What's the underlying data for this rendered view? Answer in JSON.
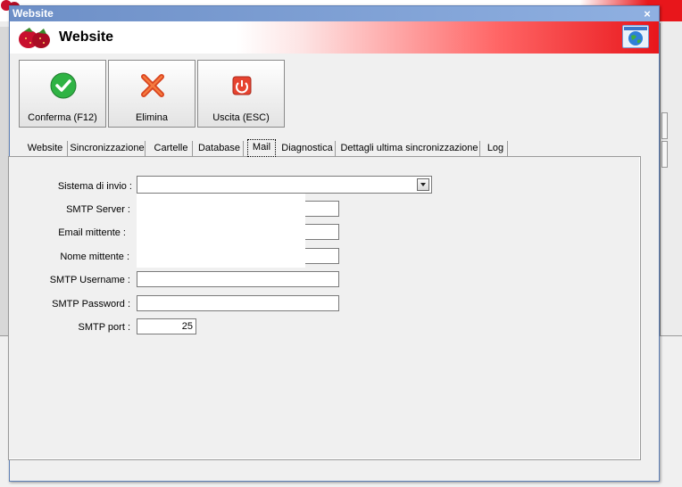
{
  "window": {
    "title": "Website",
    "close_glyph": "×"
  },
  "header": {
    "title": "Website",
    "logo_icon": "strawberry-icon",
    "globe_icon": "globe-icon"
  },
  "toolbar": {
    "buttons": [
      {
        "label": "Conferma (F12)",
        "icon": "check-icon"
      },
      {
        "label": "Elimina",
        "icon": "delete-x-icon"
      },
      {
        "label": "Uscita (ESC)",
        "icon": "power-icon"
      }
    ]
  },
  "tabs": [
    {
      "label": "Website",
      "active": false
    },
    {
      "label": "Sincronizzazione",
      "active": false
    },
    {
      "label": "Cartelle",
      "active": false
    },
    {
      "label": "Database",
      "active": false
    },
    {
      "label": "Mail",
      "active": true
    },
    {
      "label": "Diagnostica",
      "active": false
    },
    {
      "label": "Dettagli ultima sincronizzazione",
      "active": false
    },
    {
      "label": "Log",
      "active": false
    }
  ],
  "mail_form": {
    "sistema_label": "Sistema di invio :",
    "sistema_value": "",
    "smtp_server_label": "SMTP Server :",
    "smtp_server_value": "",
    "email_mittente_label": "Email mittente :",
    "email_mittente_value": "",
    "nome_mittente_label": "Nome mittente :",
    "nome_mittente_value": "",
    "smtp_username_label": "SMTP Username :",
    "smtp_username_value": "",
    "smtp_password_label": "SMTP Password :",
    "smtp_password_value": "",
    "smtp_port_label": "SMTP port :",
    "smtp_port_value": "25"
  },
  "colors": {
    "title_bar": "#6d8fc7",
    "accent_red": "#e8161b",
    "check_green": "#2fb344"
  }
}
